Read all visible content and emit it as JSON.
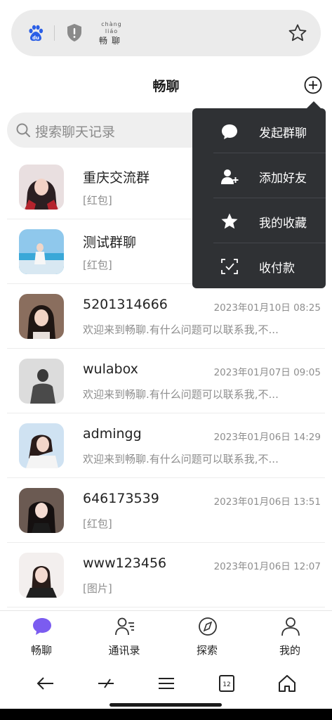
{
  "browser": {
    "brand_pinyin": "chàng liáo",
    "brand_hanzi": "畅聊",
    "icons": [
      "baidu-logo-icon",
      "shield-icon",
      "star-icon"
    ]
  },
  "header": {
    "title": "畅聊"
  },
  "search": {
    "placeholder": "搜索聊天记录"
  },
  "menu": {
    "items": [
      {
        "label": "发起群聊",
        "icon": "chat-bubble-icon"
      },
      {
        "label": "添加好友",
        "icon": "add-user-icon"
      },
      {
        "label": "我的收藏",
        "icon": "star-filled-icon"
      },
      {
        "label": "收付款",
        "icon": "payment-icon"
      }
    ]
  },
  "chats": [
    {
      "name": "重庆交流群",
      "message": "[红包]",
      "time": ""
    },
    {
      "name": "测试群聊",
      "message": "[红包]",
      "time": ""
    },
    {
      "name": "5201314666",
      "message": "欢迎来到畅聊.有什么问题可以联系我,不...",
      "time": "2023年01月10日 08:25"
    },
    {
      "name": "wulabox",
      "message": "欢迎来到畅聊.有什么问题可以联系我,不...",
      "time": "2023年01月07日 09:05"
    },
    {
      "name": "admingg",
      "message": "欢迎来到畅聊.有什么问题可以联系我,不...",
      "time": "2023年01月06日 14:29"
    },
    {
      "name": "646173539",
      "message": "[红包]",
      "time": "2023年01月06日 13:51"
    },
    {
      "name": "www123456",
      "message": "[图片]",
      "time": "2023年01月06日 12:07"
    }
  ],
  "tabs": [
    {
      "label": "畅聊",
      "icon": "chat-icon",
      "active": true
    },
    {
      "label": "通讯录",
      "icon": "contacts-icon",
      "active": false
    },
    {
      "label": "探索",
      "icon": "compass-icon",
      "active": false
    },
    {
      "label": "我的",
      "icon": "profile-icon",
      "active": false
    }
  ],
  "system_nav": {
    "tab_count": "12"
  },
  "colors": {
    "accent": "#7b5cf0",
    "menu_bg": "#2f3134",
    "baidu_blue": "#2b5fe6"
  }
}
